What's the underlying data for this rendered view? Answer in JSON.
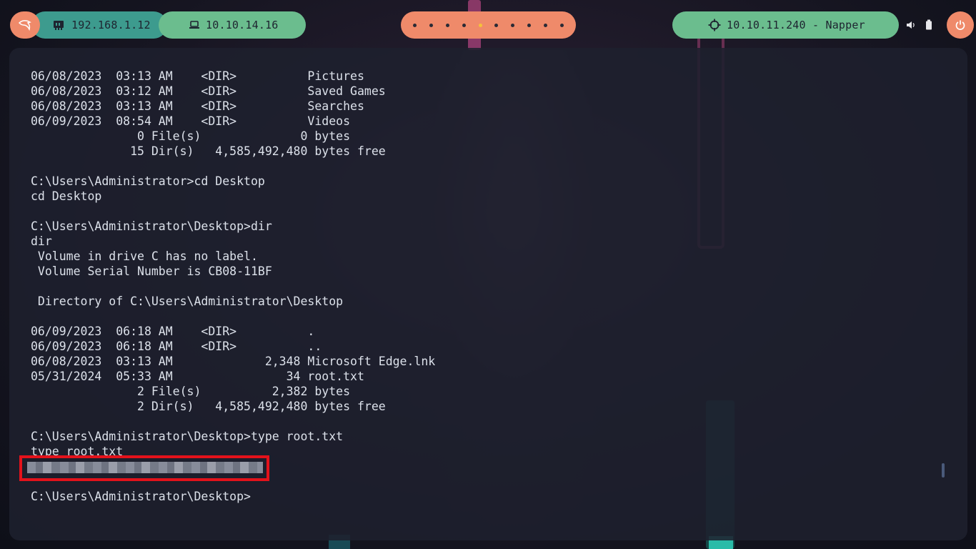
{
  "topbar": {
    "logo_icon": "kali-dragon-icon",
    "local_ip": "192.168.1.12",
    "vpn_ip": "10.10.14.16",
    "workspaces": [
      {
        "index": 1,
        "active": false
      },
      {
        "index": 2,
        "active": false
      },
      {
        "index": 3,
        "active": false
      },
      {
        "index": 4,
        "active": false
      },
      {
        "index": 5,
        "active": true
      },
      {
        "index": 6,
        "active": false
      },
      {
        "index": 7,
        "active": false
      },
      {
        "index": 8,
        "active": false
      },
      {
        "index": 9,
        "active": false
      },
      {
        "index": 10,
        "active": false
      }
    ],
    "target": "10.10.11.240 - Napper",
    "tray": {
      "volume_icon": "volume-icon",
      "battery_icon": "battery-icon"
    },
    "power_icon": "power-icon"
  },
  "terminal": {
    "lines": [
      "06/08/2023  03:13 AM    <DIR>          Pictures",
      "06/08/2023  03:12 AM    <DIR>          Saved Games",
      "06/08/2023  03:13 AM    <DIR>          Searches",
      "06/09/2023  08:54 AM    <DIR>          Videos",
      "               0 File(s)              0 bytes",
      "              15 Dir(s)   4,585,492,480 bytes free",
      "",
      "C:\\Users\\Administrator>cd Desktop",
      "cd Desktop",
      "",
      "C:\\Users\\Administrator\\Desktop>dir",
      "dir",
      " Volume in drive C has no label.",
      " Volume Serial Number is CB08-11BF",
      "",
      " Directory of C:\\Users\\Administrator\\Desktop",
      "",
      "06/09/2023  06:18 AM    <DIR>          .",
      "06/09/2023  06:18 AM    <DIR>          ..",
      "06/08/2023  03:13 AM             2,348 Microsoft Edge.lnk",
      "05/31/2024  05:33 AM                34 root.txt",
      "               2 File(s)          2,382 bytes",
      "               2 Dir(s)   4,585,492,480 bytes free",
      "",
      "C:\\Users\\Administrator\\Desktop>type root.txt",
      "type root.txt",
      "",
      "",
      "C:\\Users\\Administrator\\Desktop>"
    ]
  },
  "colors": {
    "accent_orange": "#ef8a6a",
    "accent_green": "#6bbd8e",
    "accent_teal": "#3d9b8e",
    "terminal_text": "#dce1ea",
    "highlight_red": "#e3121b"
  }
}
